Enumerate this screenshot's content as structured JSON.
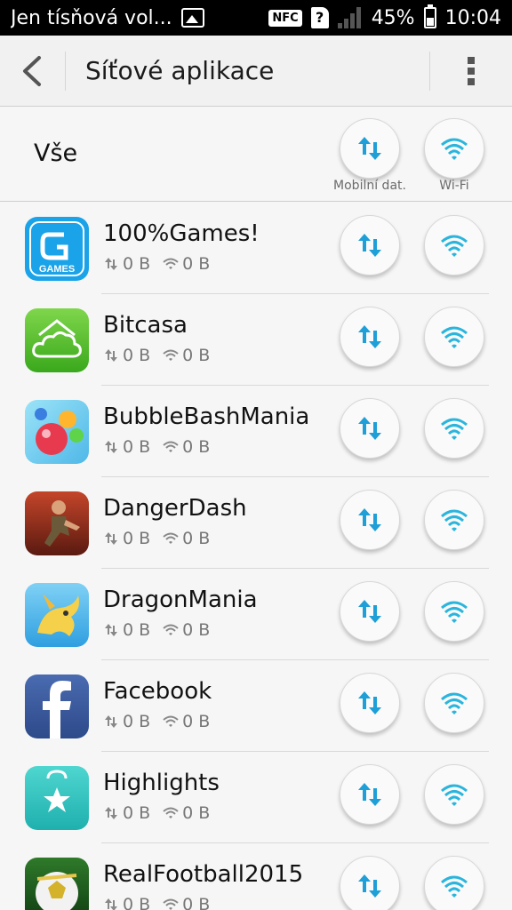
{
  "status_bar": {
    "notification_text": "Jen tísňová vol...",
    "nfc_label": "NFC",
    "sim_label": "?",
    "battery": "45%",
    "time": "10:04"
  },
  "header": {
    "title": "Síťové aplikace",
    "back_icon": "back-arrow-icon",
    "menu_icon": "overflow-menu-icon"
  },
  "all_row": {
    "label": "Vše",
    "mobile_label": "Mobilní dat.",
    "wifi_label": "Wi-Fi"
  },
  "colors": {
    "accent_blue": "#1e9fd8",
    "wifi_cyan": "#2bb5dc"
  },
  "apps": [
    {
      "name": "100%Games!",
      "mobile_usage": "0 B",
      "wifi_usage": "0 B",
      "icon": "games-icon"
    },
    {
      "name": "Bitcasa",
      "mobile_usage": "0 B",
      "wifi_usage": "0 B",
      "icon": "bitcasa-cloud-icon"
    },
    {
      "name": "BubbleBashMania",
      "mobile_usage": "0 B",
      "wifi_usage": "0 B",
      "icon": "bubble-icon"
    },
    {
      "name": "DangerDash",
      "mobile_usage": "0 B",
      "wifi_usage": "0 B",
      "icon": "dangerdash-icon"
    },
    {
      "name": "DragonMania",
      "mobile_usage": "0 B",
      "wifi_usage": "0 B",
      "icon": "dragon-icon"
    },
    {
      "name": "Facebook",
      "mobile_usage": "0 B",
      "wifi_usage": "0 B",
      "icon": "facebook-icon"
    },
    {
      "name": "Highlights",
      "mobile_usage": "0 B",
      "wifi_usage": "0 B",
      "icon": "highlights-star-icon"
    },
    {
      "name": "RealFootball2015",
      "mobile_usage": "0 B",
      "wifi_usage": "0 B",
      "icon": "football-icon"
    }
  ]
}
